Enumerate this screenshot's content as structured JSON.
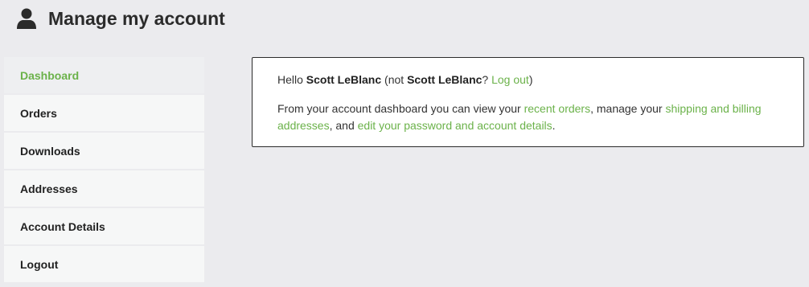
{
  "header": {
    "title": "Manage my account",
    "icon": "user-icon"
  },
  "sidebar": {
    "items": [
      {
        "label": "Dashboard",
        "active": true
      },
      {
        "label": "Orders"
      },
      {
        "label": "Downloads"
      },
      {
        "label": "Addresses"
      },
      {
        "label": "Account Details"
      },
      {
        "label": "Logout"
      }
    ]
  },
  "dashboard": {
    "greeting_prefix": "Hello ",
    "user_name": "Scott LeBlanc",
    "not_prefix": " (not ",
    "not_user_name": "Scott LeBlanc",
    "not_suffix": "? ",
    "logout_link": "Log out",
    "close_paren": ")",
    "body_text_1": "From your account dashboard you can view your ",
    "recent_orders_link": "recent orders",
    "body_text_2": ", manage your ",
    "addresses_link": "shipping and billing addresses",
    "body_text_3": ", and ",
    "account_details_link": "edit your password and account details",
    "body_text_4": "."
  },
  "colors": {
    "accent": "#6bb24a",
    "background": "#ebebee",
    "panel_border": "#2b2b2b"
  }
}
